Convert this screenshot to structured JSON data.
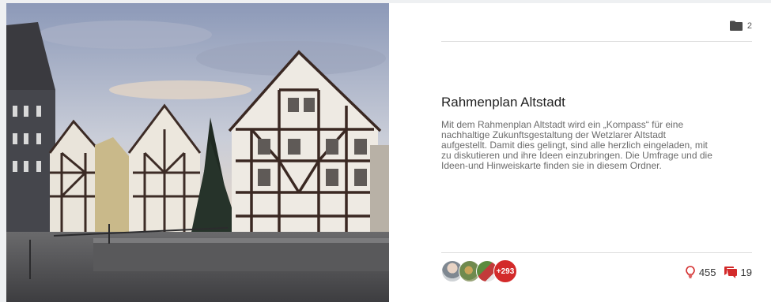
{
  "card": {
    "title": "Rahmenplan Altstadt",
    "description": "Mit dem Rahmenplan Altstadt wird ein „Kompass“ für eine nachhaltige Zukunftsgestaltung der Wetzlarer Altstadt aufgestellt. Damit dies gelingt, sind alle herzlich eingeladen, mit zu diskutieren und ihre Ideen einzubringen. Die Umfrage und die Ideen-und Hinweiskarte finden sie in diesem Ordner.",
    "folder_count": "2",
    "participants_more": "+293",
    "ideas_count": "455",
    "comments_count": "19"
  },
  "icons": {
    "folder": "folder-icon",
    "idea": "lightbulb-icon",
    "comments": "comments-icon"
  },
  "colors": {
    "accent": "#d32a2a",
    "text_muted": "#6b6b6b"
  }
}
